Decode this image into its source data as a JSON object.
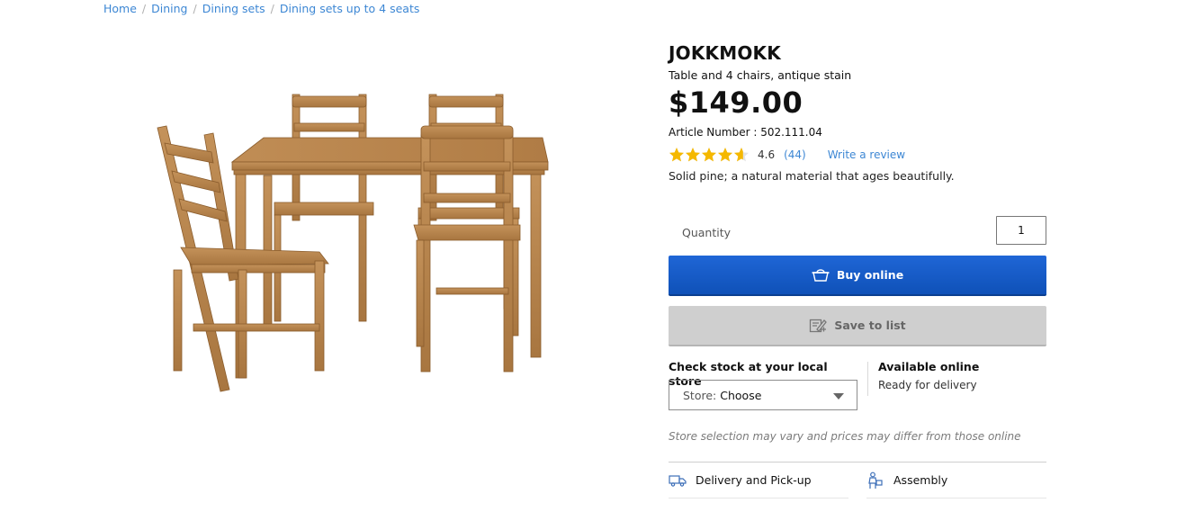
{
  "breadcrumb": {
    "items": [
      "Home",
      "Dining",
      "Dining sets",
      "Dining sets up to 4 seats"
    ],
    "separator": "/"
  },
  "product": {
    "name": "JOKKMOKK",
    "subtitle": "Table and 4 chairs, antique stain",
    "price": "$149.00",
    "article_label": "Article Number : ",
    "article_number": "502.111.04",
    "rating": {
      "value": "4.6",
      "count": "(44)",
      "stars_filled_fraction": 0.92,
      "write_review": "Write a review"
    },
    "description": "Solid pine; a natural material that ages beautifully.",
    "wood_color": "#b8864b"
  },
  "quantity": {
    "label": "Quantity",
    "value": "1"
  },
  "buttons": {
    "buy_label": "Buy online",
    "buy_icon": "shopping-bag-icon",
    "save_label": "Save to list",
    "save_icon": "add-to-list-icon"
  },
  "stock": {
    "title": "Check stock at your local store",
    "store_label": "Store:",
    "store_value": "Choose",
    "available_title": "Available online",
    "available_sub": "Ready for delivery"
  },
  "note": "Store selection may vary and prices may differ from those online",
  "services": {
    "delivery": {
      "label": "Delivery and Pick-up",
      "icon": "truck-icon"
    },
    "assembly": {
      "label": "Assembly",
      "icon": "assembly-person-icon"
    }
  },
  "colors": {
    "link": "#3d87d4",
    "buy_button": "#0f58c4",
    "save_button": "#cfcfcf",
    "star": "#f5b800"
  }
}
